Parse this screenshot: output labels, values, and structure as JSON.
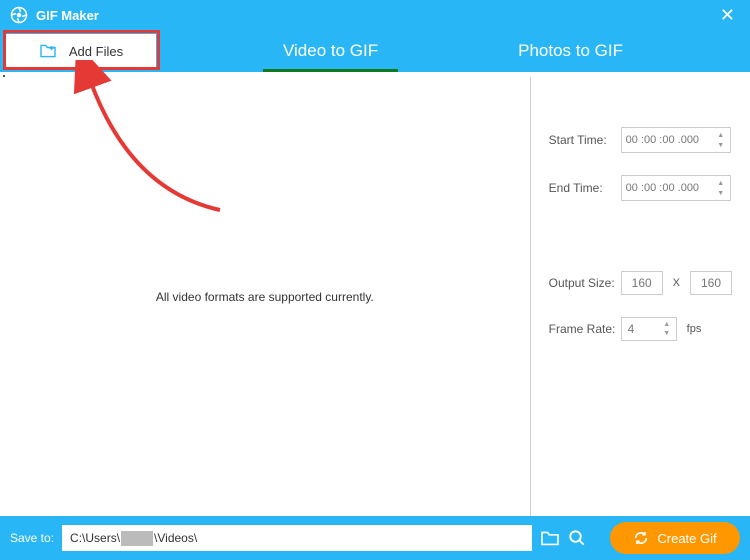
{
  "title": "GIF Maker",
  "toolbar": {
    "add_files_label": "Add Files"
  },
  "tabs": {
    "video_to_gif": "Video to GIF",
    "photos_to_gif": "Photos to GIF"
  },
  "preview": {
    "placeholder_text": "All video formats are supported currently."
  },
  "settings": {
    "start_time_label": "Start Time:",
    "start_time_value": "00 :00 :00 .000",
    "end_time_label": "End Time:",
    "end_time_value": "00 :00 :00 .000",
    "output_size_label": "Output Size:",
    "output_width": "160",
    "output_x": "X",
    "output_height": "160",
    "frame_rate_label": "Frame Rate:",
    "frame_rate_value": "4",
    "fps_unit": "fps"
  },
  "bottombar": {
    "save_to_label": "Save to:",
    "path_prefix": "C:\\Users\\",
    "path_suffix": "\\Videos\\",
    "create_label": "Create Gif"
  }
}
